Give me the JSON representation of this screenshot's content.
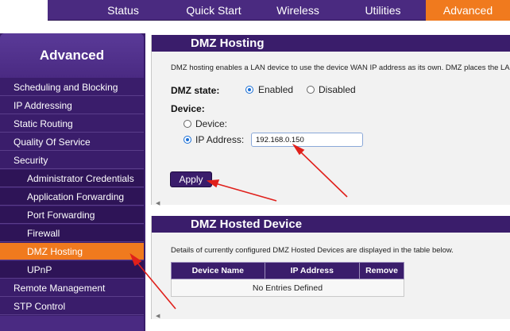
{
  "topnav": {
    "tabs": [
      {
        "label": "Status"
      },
      {
        "label": "Quick Start"
      },
      {
        "label": "Wireless"
      },
      {
        "label": "Utilities"
      },
      {
        "label": "Advanced"
      }
    ]
  },
  "sidebar": {
    "title": "Advanced",
    "items": [
      {
        "label": "Scheduling and Blocking"
      },
      {
        "label": "IP Addressing"
      },
      {
        "label": "Static Routing"
      },
      {
        "label": "Quality Of Service"
      },
      {
        "label": "Security"
      },
      {
        "label": "Administrator Credentials"
      },
      {
        "label": "Application Forwarding"
      },
      {
        "label": "Port Forwarding"
      },
      {
        "label": "Firewall"
      },
      {
        "label": "DMZ Hosting"
      },
      {
        "label": "UPnP"
      },
      {
        "label": "Remote Management"
      },
      {
        "label": "STP Control"
      }
    ]
  },
  "dmz": {
    "title": "DMZ Hosting",
    "description": "DMZ hosting enables a LAN device to use the device WAN IP address as its own. DMZ places the LAN dev",
    "state_label": "DMZ state:",
    "enabled_label": "Enabled",
    "disabled_label": "Disabled",
    "device_heading": "Device:",
    "device_option_label": "Device:",
    "ip_option_label": "IP Address:",
    "ip_value": "192.168.0.150",
    "apply_label": "Apply"
  },
  "hosted": {
    "title": "DMZ Hosted Device",
    "description": "Details of currently configured DMZ Hosted Devices are displayed in the table below.",
    "columns": [
      "Device Name",
      "IP Address",
      "Remove"
    ],
    "empty_text": "No Entries Defined"
  },
  "colors": {
    "brand_purple": "#3a1d6b",
    "accent_orange": "#f07a1e",
    "annotation_red": "#e0201b"
  }
}
